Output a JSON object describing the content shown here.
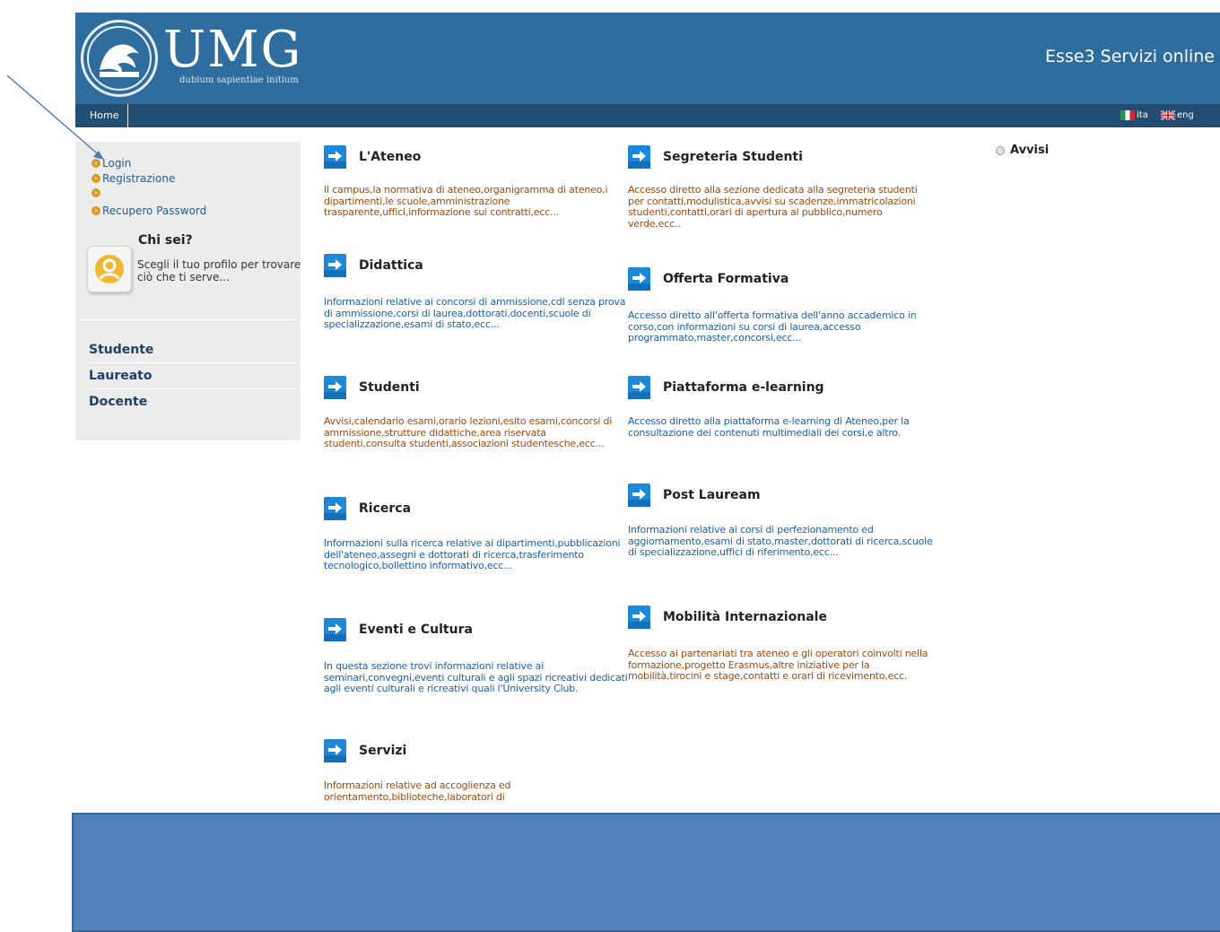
{
  "header": {
    "logo_text": "UMG",
    "logo_motto": "dubium sapientiae initium",
    "site_title": "Esse3 Servizi online"
  },
  "nav": {
    "home": "Home",
    "lang_ita": "ita",
    "lang_eng": "eng"
  },
  "sidebar": {
    "auth_links": [
      "Login",
      "Registrazione",
      "",
      "Recupero Password"
    ],
    "who_title": "Chi sei?",
    "who_desc": "Scegli il tuo profilo per trovare ciò che ti serve...",
    "profiles": [
      "Studente",
      "Laureato",
      "Docente"
    ]
  },
  "sections_left": [
    {
      "title": "L'Ateneo",
      "desc": "Il campus,la normativa di ateneo,organigramma di ateneo,i dipartimenti,le scuole,amministrazione trasparente,uffici,informazione sui contratti,ecc...",
      "color": "#9b4a0f"
    },
    {
      "title": "Didattica",
      "desc": "Informazioni relative ai concorsi di ammissione,cdl senza prova di ammissione,corsi di laurea,dottorati,docenti,scuole di specializzazione,esami di stato,ecc...",
      "color": "#1a5fa8"
    },
    {
      "title": "Studenti",
      "desc": "Avvisi,calendario esami,orario lezioni,esito esami,concorsi di ammissione,strutture didattiche,area riservata studenti,consulta studenti,associazioni studentesche,ecc...",
      "color": "#9b4a0f"
    },
    {
      "title": "Ricerca",
      "desc": "Informazioni sulla ricerca relative ai dipartimenti,pubblicazioni dell'ateneo,assegni e dottorati di ricerca,trasferimento tecnologico,bollettino informativo,ecc...",
      "color": "#1a5fa8"
    },
    {
      "title": "Eventi e Cultura",
      "desc": "In questa sezione trovi informazioni relative ai seminari,convegni,eventi culturali e agli spazi ricreativi dedicati agli eventi culturali e ricreativi quali l'University Club.",
      "color": "#1a5fa8"
    },
    {
      "title": "Servizi",
      "desc": "Informazioni relative ad accoglienza ed orientamento,biblioteche,laboratori di",
      "color": "#9b4a0f"
    }
  ],
  "sections_right": [
    {
      "title": "Segreteria Studenti",
      "desc": "Accesso diretto alla sezione dedicata alla segreteria studenti per contatti,modulistica,avvisi su scadenze,immatricolazioni studenti,contatti,orari di apertura al pubblico,numero verde,ecc..",
      "color": "#9b4a0f"
    },
    {
      "title": "Offerta Formativa",
      "desc": "Accesso diretto all'offerta formativa dell'anno accademico in corso,con informazioni su corsi di laurea,accesso programmato,master,concorsi,ecc...",
      "color": "#1a5fa8"
    },
    {
      "title": "Piattaforma e-learning",
      "desc": "Accesso diretto alla piattaforma e-learning di Ateneo,per la consultazione dei contenuti multimediali dei corsi,e altro.",
      "color": "#1a5fa8"
    },
    {
      "title": "Post Lauream",
      "desc": "Informazioni relative ai corsi di perfezionamento ed aggiornamento,esami di stato,master,dottorati di ricerca,scuole di specializzazione,uffici di riferimento,ecc...",
      "color": "#1a5fa8"
    },
    {
      "title": "Mobilità Internazionale",
      "desc": "Accesso ai partenariati tra ateneo e gli operatori coinvolti nella formazione,progetto Erasmus,altre iniziative per la mobilità,tirocini e stage,contatti e orari di ricevimento,ecc.",
      "color": "#9b4a0f"
    }
  ],
  "avvisi": "Avvisi",
  "colors": {
    "header": "#2f6d9f",
    "navbar": "#244e71",
    "overlay": "#4f81bd",
    "orange_text": "#9b4a0f",
    "blue_text": "#1a5fa8"
  }
}
